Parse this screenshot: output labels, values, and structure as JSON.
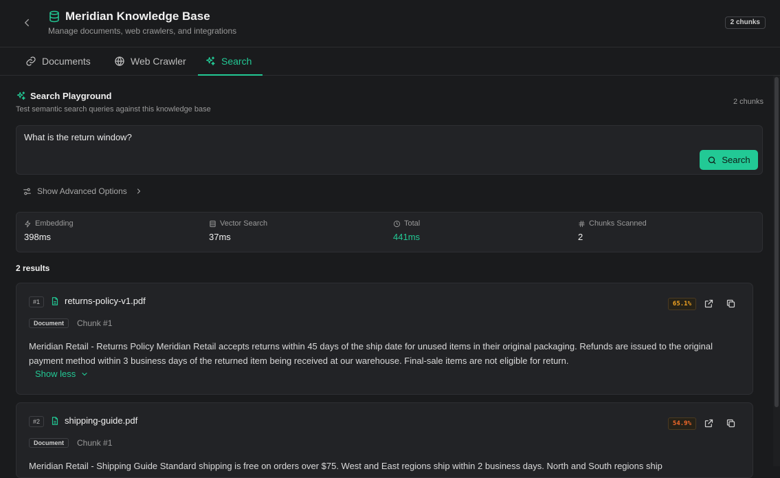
{
  "header": {
    "title": "Meridian Knowledge Base",
    "subtitle": "Manage documents, web crawlers, and integrations",
    "badge": "2 chunks"
  },
  "tabs": [
    {
      "label": "Documents",
      "active": false
    },
    {
      "label": "Web Crawler",
      "active": false
    },
    {
      "label": "Search",
      "active": true
    }
  ],
  "playground": {
    "title": "Search Playground",
    "subtitle": "Test semantic search queries against this knowledge base",
    "count": "2 chunks",
    "query": "What is the return window?",
    "search_label": "Search",
    "advanced_label": "Show Advanced Options"
  },
  "metrics": [
    {
      "label": "Embedding",
      "value": "398ms"
    },
    {
      "label": "Vector Search",
      "value": "37ms"
    },
    {
      "label": "Total",
      "value": "441ms"
    },
    {
      "label": "Chunks Scanned",
      "value": "2"
    }
  ],
  "results_count": "2 results",
  "results": [
    {
      "rank": "#1",
      "file": "returns-policy-v1.pdf",
      "score": "65.1%",
      "score_color": "#f5a623",
      "type": "Document",
      "chunk": "Chunk #1",
      "text": "Meridian Retail - Returns Policy Meridian Retail accepts returns within 45 days of the ship date for unused items in their original packaging. Refunds are issued to the original payment method within 3 business days of the returned item being received at our warehouse. Final-sale items are not eligible for return.",
      "toggle": "Show less"
    },
    {
      "rank": "#2",
      "file": "shipping-guide.pdf",
      "score": "54.9%",
      "score_color": "#f56a2a",
      "type": "Document",
      "chunk": "Chunk #1",
      "text": "Meridian Retail - Shipping Guide Standard shipping is free on orders over $75. West and East regions ship within 2 business days. North and South regions ship"
    }
  ],
  "colors": {
    "accent": "#22c995",
    "background": "#1a1b1d",
    "panel": "#222326"
  }
}
